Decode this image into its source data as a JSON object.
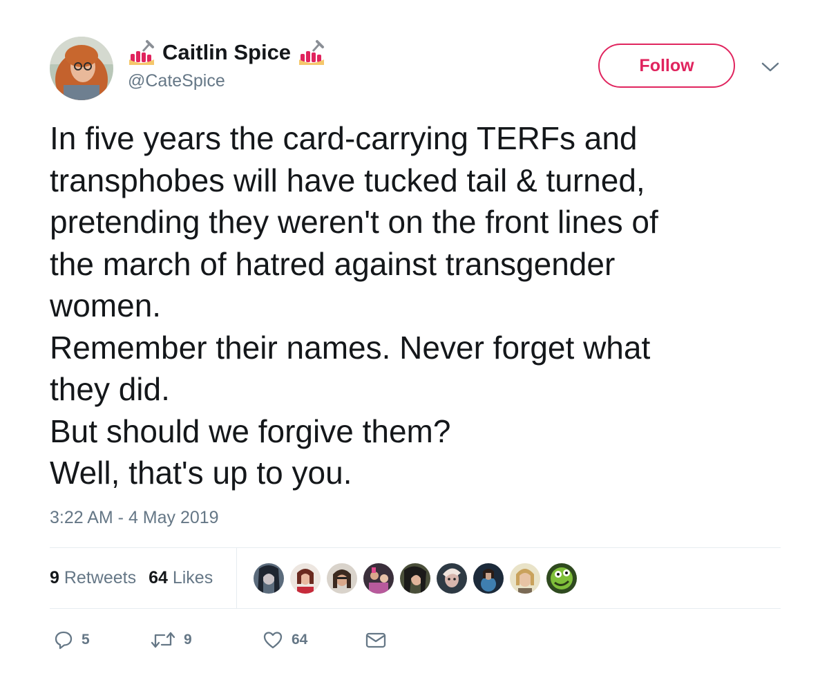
{
  "author": {
    "display_name": "Caitlin Spice",
    "handle": "@CateSpice",
    "name_emoji": "nail-polish-icon"
  },
  "follow_button": {
    "label": "Follow"
  },
  "more_menu": {
    "icon": "chevron-down-icon"
  },
  "tweet": {
    "lines": [
      "In five years the card-carrying TERFs and",
      "transphobes will have tucked tail & turned,",
      "pretending they weren't on the front lines of",
      "the march of hatred against transgender",
      "women.",
      "Remember their names. Never forget what",
      "they did.",
      "But should we forgive them?",
      "Well, that's up to you."
    ],
    "timestamp": "3:22 AM - 4 May 2019"
  },
  "stats": {
    "retweets_count": "9",
    "retweets_label": "Retweets",
    "likes_count": "64",
    "likes_label": "Likes"
  },
  "liker_avatars": 9,
  "actions": {
    "reply_count": "5",
    "retweet_count": "9",
    "like_count": "64"
  },
  "colors": {
    "accent": "#e0245e",
    "text": "#14171a",
    "secondary": "#657786",
    "divider": "#e6ecf0"
  }
}
